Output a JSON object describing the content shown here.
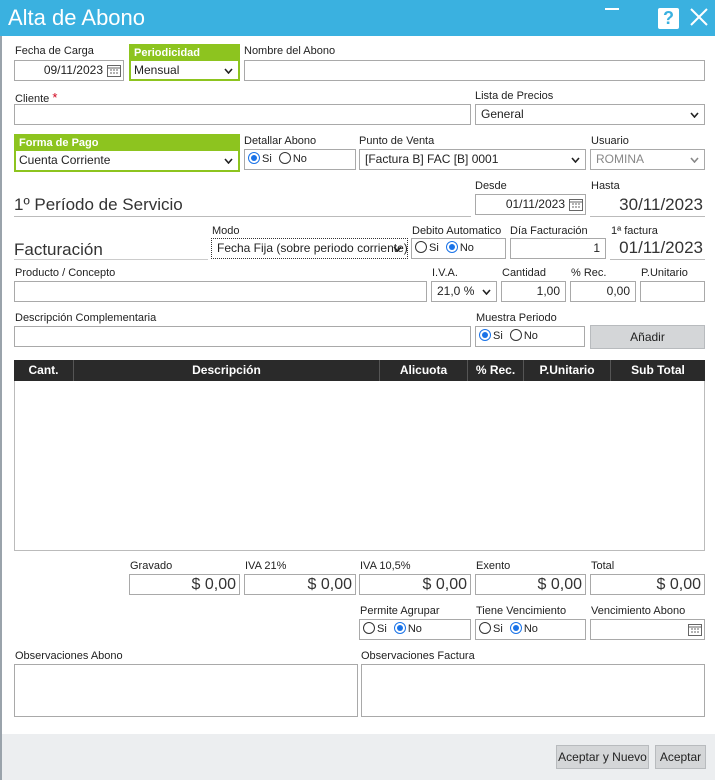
{
  "window": {
    "title": "Alta de Abono"
  },
  "header": {
    "fecha_carga_label": "Fecha de Carga",
    "fecha_carga": "09/11/2023",
    "periodicidad_label": "Periodicidad",
    "periodicidad": "Mensual",
    "nombre_label": "Nombre del Abono",
    "nombre": ""
  },
  "cliente": {
    "label": "Cliente",
    "required_mark": "*",
    "value": ""
  },
  "lista_precios": {
    "label": "Lista de Precios",
    "value": "General"
  },
  "forma_pago": {
    "label": "Forma de Pago",
    "value": "Cuenta Corriente"
  },
  "detallar": {
    "label": "Detallar Abono",
    "si": "Si",
    "no": "No",
    "selected": "Si"
  },
  "punto_venta": {
    "label": "Punto de Venta",
    "value": "[Factura B] FAC [B] 0001"
  },
  "usuario": {
    "label": "Usuario",
    "value": "ROMINA"
  },
  "periodo": {
    "title": "1º Período de Servicio",
    "desde_label": "Desde",
    "desde": "01/11/2023",
    "hasta_label": "Hasta",
    "hasta": "30/11/2023"
  },
  "facturacion": {
    "title": "Facturación",
    "modo_label": "Modo",
    "modo": "Fecha Fija (sobre periodo corriente)",
    "debito_label": "Debito Automatico",
    "debito_si": "Si",
    "debito_no": "No",
    "debito_selected": "No",
    "dia_label": "Día Facturación",
    "dia": "1",
    "primera_label": "1ª factura",
    "primera": "01/11/2023"
  },
  "producto": {
    "label": "Producto / Concepto",
    "value": "",
    "iva_label": "I.V.A.",
    "iva": "21,0 %",
    "cantidad_label": "Cantidad",
    "cantidad": "1,00",
    "rec_label": "% Rec.",
    "rec": "0,00",
    "punitario_label": "P.Unitario",
    "punitario": ""
  },
  "descripcion": {
    "label": "Descripción Complementaria",
    "value": "",
    "muestra_label": "Muestra Periodo",
    "muestra_si": "Si",
    "muestra_no": "No",
    "muestra_selected": "Si",
    "add_button": "Añadir"
  },
  "table": {
    "columns": [
      "Cant.",
      "Descripción",
      "Alicuota",
      "% Rec.",
      "P.Unitario",
      "Sub Total"
    ],
    "rows": []
  },
  "totals": {
    "gravado_label": "Gravado",
    "gravado": "$ 0,00",
    "iva21_label": "IVA 21%",
    "iva21": "$ 0,00",
    "iva105_label": "IVA 10,5%",
    "iva105": "$ 0,00",
    "exento_label": "Exento",
    "exento": "$ 0,00",
    "total_label": "Total",
    "total": "$ 0,00"
  },
  "options": {
    "agrupar_label": "Permite Agrupar",
    "agrupar_si": "Si",
    "agrupar_no": "No",
    "agrupar_selected": "No",
    "vencimiento_label": "Tiene Vencimiento",
    "vencimiento_si": "Si",
    "vencimiento_no": "No",
    "vencimiento_selected": "No",
    "venc_abono_label": "Vencimiento Abono",
    "venc_abono": ""
  },
  "observaciones": {
    "abono_label": "Observaciones Abono",
    "factura_label": "Observaciones Factura"
  },
  "footer": {
    "accept_new": "Aceptar y Nuevo",
    "accept": "Aceptar"
  },
  "colors": {
    "titlebar": "#3ab1e0",
    "green": "#8dc41f",
    "radio": "#1a73e8"
  }
}
